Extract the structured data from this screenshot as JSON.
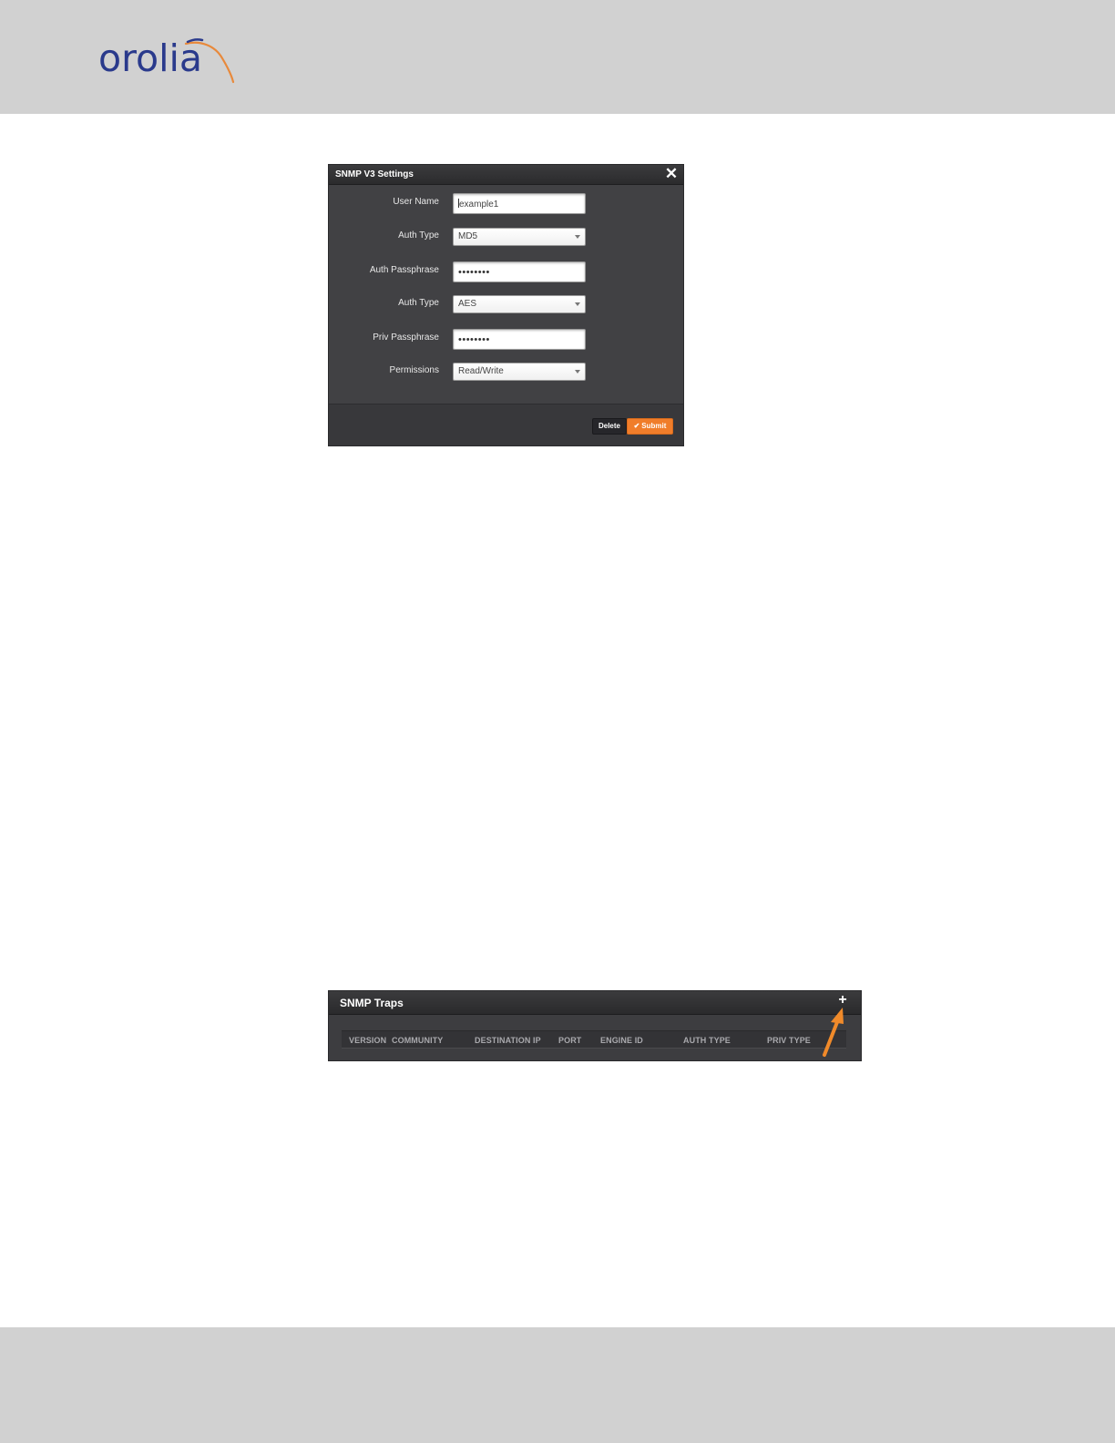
{
  "brand": {
    "logo_text": "orolia",
    "logo_colors": {
      "primary": "#2a3a8c",
      "accent": "#e8893b"
    }
  },
  "snmp_v3_dialog": {
    "title": "SNMP V3 Settings",
    "close_icon": "close-icon",
    "fields": {
      "user_name": {
        "label": "User Name",
        "value": "example1"
      },
      "auth_type": {
        "label": "Auth Type",
        "value": "MD5"
      },
      "auth_passphrase": {
        "label": "Auth Passphrase",
        "value": "••••••••"
      },
      "priv_type": {
        "label": "Auth Type",
        "value": "AES"
      },
      "priv_passphrase": {
        "label": "Priv Passphrase",
        "value": "••••••••"
      },
      "permissions": {
        "label": "Permissions",
        "value": "Read/Write"
      }
    },
    "buttons": {
      "delete": "Delete",
      "submit": "Submit"
    },
    "accent_color": "#f07d2a"
  },
  "snmp_traps": {
    "title": "SNMP Traps",
    "add_icon": "plus-icon",
    "columns": [
      "VERSION",
      "COMMUNITY",
      "DESTINATION IP",
      "PORT",
      "ENGINE ID",
      "AUTH TYPE",
      "PRIV TYPE"
    ],
    "highlight_arrow_color": "#f08a2a"
  }
}
